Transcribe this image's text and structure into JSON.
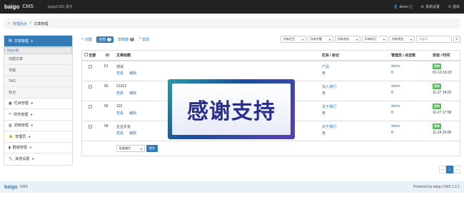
{
  "topbar": {
    "brand": "baigo",
    "brand2": "CMS",
    "site": "baigoCMS 演示",
    "user": "demo [ ]",
    "settings": "系统设置",
    "logout": "退出"
  },
  "breadcrumb": {
    "home": "管理后台",
    "current": "文章管理"
  },
  "sidebar": {
    "items": [
      {
        "label": "文章管理",
        "type": "active"
      },
      {
        "label": "所有文章",
        "type": "sub-sel"
      },
      {
        "label": "创建文章",
        "type": "sub"
      },
      {
        "label": "专题",
        "type": "sub"
      },
      {
        "label": "TAG",
        "type": "sub"
      },
      {
        "label": "标记",
        "type": "sub"
      },
      {
        "label": "栏目管理",
        "type": "normal"
      },
      {
        "label": "附件管理",
        "type": "normal"
      },
      {
        "label": "调用管理",
        "type": "normal"
      },
      {
        "label": "管理员",
        "type": "normal"
      },
      {
        "label": "群组管理",
        "type": "normal"
      },
      {
        "label": "其他设置",
        "type": "normal"
      }
    ]
  },
  "toolbar": {
    "create": "创建",
    "all": "全部",
    "all_count": "4",
    "draft": "草稿箱",
    "draft_count": "0",
    "help": "帮助"
  },
  "filters": [
    "所有栏目",
    "所有专题",
    "所有状态",
    "所有标记",
    "所有状态"
  ],
  "search": {
    "placeholder": "关键词"
  },
  "table": {
    "headers": {
      "all": "全部",
      "id": "ID",
      "title": "文章标题",
      "cate": "栏目 / 标记",
      "admin": "管理员 / 点击数",
      "status": "状态 / 时间"
    },
    "rows": [
      {
        "id": "61",
        "title": "测试",
        "view": "查看",
        "edit": "编辑",
        "cate": "产品",
        "mark": "无",
        "admin": "demo",
        "hits": "0",
        "status": "发布",
        "time": "01-13 16:20"
      },
      {
        "id": "60",
        "title": "21312",
        "view": "查看",
        "edit": "编辑",
        "cate": "加入我们",
        "mark": "无",
        "admin": "demo",
        "hits": "0",
        "status": "发布",
        "time": "11-27 18:02"
      },
      {
        "id": "59",
        "title": "123",
        "view": "查看",
        "edit": "编辑",
        "cate": "关于我们",
        "mark": "无",
        "admin": "demo",
        "hits": "0",
        "status": "发布",
        "time": "11-27 17:58"
      },
      {
        "id": "58",
        "title": "企业文化",
        "view": "查看",
        "edit": "编辑",
        "cate": "关于我们",
        "mark": "无",
        "admin": "demo",
        "hits": "0",
        "status": "发布",
        "time": "11-24 20:00"
      }
    ],
    "bulk": "批量操作",
    "submit": "提交"
  },
  "pager": {
    "prev": "«",
    "page": "1",
    "next": "»"
  },
  "footer": {
    "brand": "baigo",
    "brand2": "CMS",
    "powered": "Powered by baigo CMS 1.2.1"
  },
  "overlay": {
    "text": "感谢支持"
  }
}
